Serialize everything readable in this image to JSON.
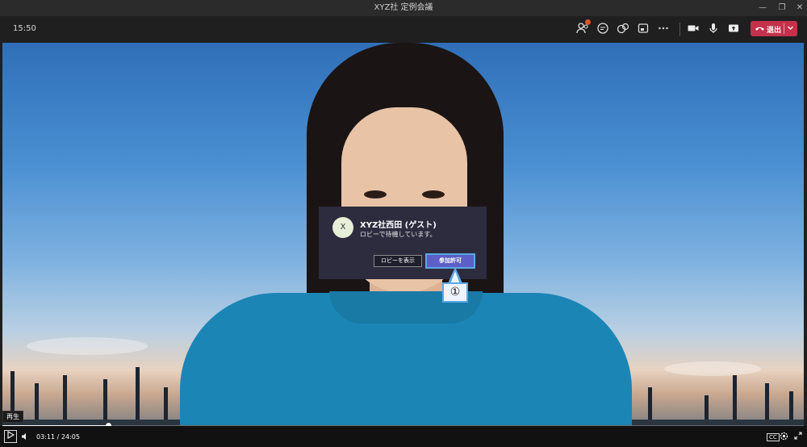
{
  "window": {
    "title": "XYZ社  定例会議",
    "controls": [
      "minimize-icon",
      "restore-icon",
      "close-icon"
    ]
  },
  "toolbar": {
    "clock": "15:50",
    "icons": [
      "participants-icon",
      "chat-icon",
      "reactions-icon",
      "rooms-icon",
      "more-icon",
      "camera-icon",
      "mic-icon",
      "share-icon"
    ],
    "leave_label": "退出",
    "leave_color": "#c4314b"
  },
  "lobby": {
    "avatar_initial": "X",
    "name": "XYZ社西田 (ゲスト)",
    "status": "ロビーで待機しています。",
    "view_lobby_label": "ロビーを表示",
    "admit_label": "参加許可",
    "annotation": "①"
  },
  "player": {
    "tooltip": "再生",
    "current_time": "03:11",
    "separator": "/",
    "total_time": "24:05",
    "progress_fraction": 0.132,
    "right_icons": [
      "subtitles-icon",
      "settings-icon",
      "fullscreen-icon"
    ],
    "cc_label": "CC"
  }
}
